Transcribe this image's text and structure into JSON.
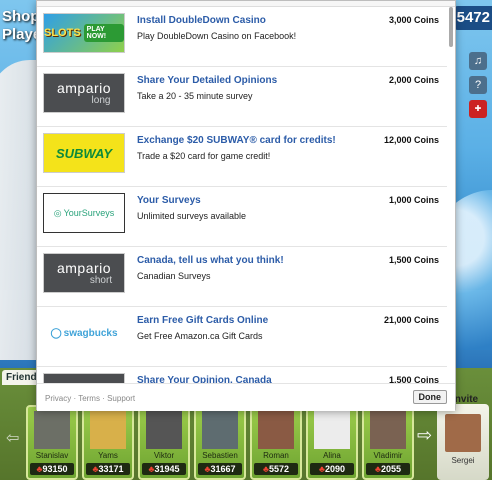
{
  "game": {
    "top_left_line1": "Shop",
    "top_left_line2": "Playe",
    "top_right_value": "5472"
  },
  "side_icons": [
    "speaker-icon",
    "help-icon",
    "flag-icon"
  ],
  "offers": [
    {
      "logo": "doubledown-slots",
      "logo_text1": "SLOTS",
      "logo_text2": "PLAY NOW!",
      "title": "Install DoubleDown Casino",
      "desc": "Play DoubleDown Casino on Facebook!",
      "coins": "3,000 Coins"
    },
    {
      "logo": "ampario",
      "logo_text1": "ampario",
      "logo_text2": "long",
      "title": "Share Your Detailed Opinions",
      "desc": "Take a 20 - 35 minute survey",
      "coins": "2,000 Coins"
    },
    {
      "logo": "subway",
      "logo_text1": "SUBWAY",
      "title": "Exchange $20 SUBWAY® card for credits!",
      "desc": "Trade a $20 card for game credit!",
      "coins": "12,000 Coins"
    },
    {
      "logo": "yoursurveys",
      "logo_text1": "YourSurveys",
      "title": "Your Surveys",
      "desc": "Unlimited surveys available",
      "coins": "1,000 Coins"
    },
    {
      "logo": "ampario",
      "logo_text1": "ampario",
      "logo_text2": "short",
      "title": "Canada, tell us what you think!",
      "desc": "Canadian Surveys",
      "coins": "1,500 Coins"
    },
    {
      "logo": "swagbucks",
      "logo_text1": "swagbucks",
      "title": "Earn Free Gift Cards Online",
      "desc": "Get Free Amazon.ca Gift Cards",
      "coins": "21,000 Coins"
    },
    {
      "logo": "ampario",
      "logo_text1": "",
      "logo_text2": "",
      "title": "Share Your Opinion, Canada",
      "desc": "",
      "coins": "1,500 Coins"
    }
  ],
  "footer": {
    "links": "Privacy · Terms · Support",
    "done_label": "Done"
  },
  "friends_bar": {
    "tab_label": "Friends",
    "invite_label": "Invite",
    "friends": [
      {
        "name": "Stanislav",
        "score": "93150"
      },
      {
        "name": "Yams",
        "score": "33171"
      },
      {
        "name": "Viktor",
        "score": "31945"
      },
      {
        "name": "Sebastien",
        "score": "31667"
      },
      {
        "name": "Roman",
        "score": "5572"
      },
      {
        "name": "Alina",
        "score": "2090"
      },
      {
        "name": "Vladimir",
        "score": "2055"
      }
    ],
    "invite_friend_name": "Sergei"
  },
  "colors": {
    "offer_title": "#2c5ca8",
    "friend_card": "#9ccc4b",
    "score_chip": "#e43"
  }
}
